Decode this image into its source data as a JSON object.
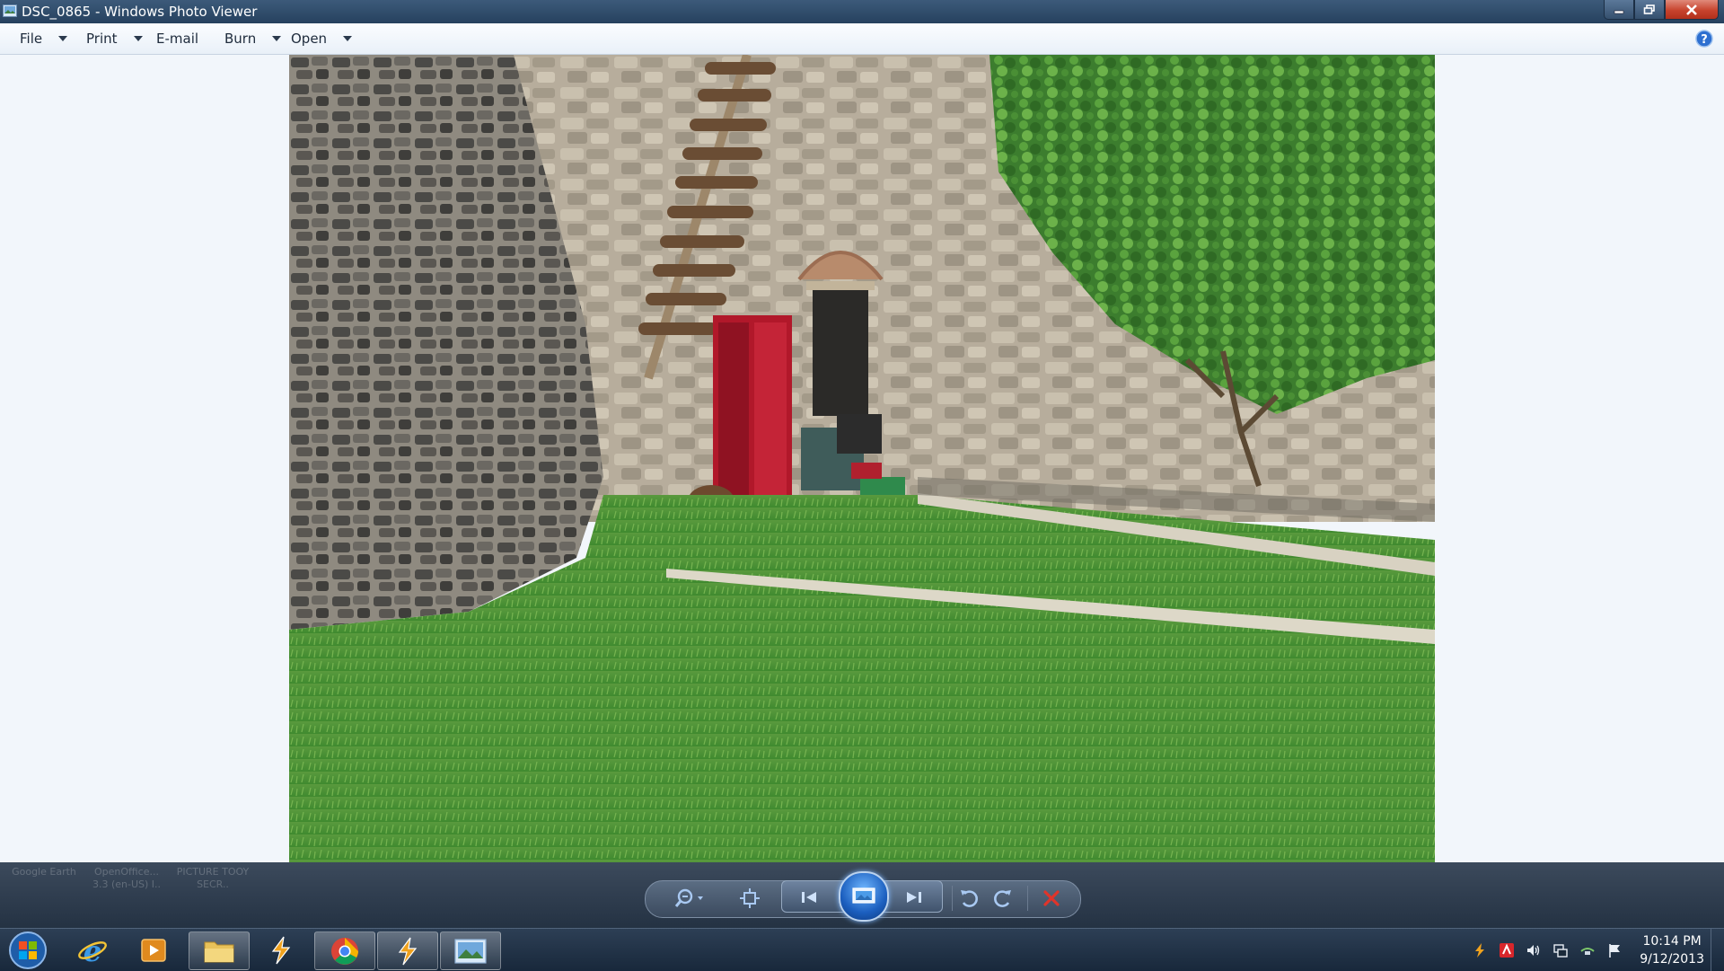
{
  "window": {
    "title": "DSC_0865 - Windows Photo Viewer"
  },
  "menu": {
    "file": "File",
    "print": "Print",
    "email": "E-mail",
    "burn": "Burn",
    "open": "Open"
  },
  "desktop_ghost_labels": [
    "Google Earth",
    "OpenOffice... 3.3 (en-US) I..",
    "PICTURE TOOY SECR.."
  ],
  "controls": [
    "zoom-icon",
    "actual-size-icon",
    "previous-icon",
    "slideshow-icon",
    "next-icon",
    "rotate-counterclockwise-icon",
    "rotate-clockwise-icon",
    "delete-icon"
  ],
  "taskbar": {
    "apps": [
      "internet-explorer",
      "media-player",
      "file-explorer",
      "winamp",
      "chrome",
      "winamp",
      "photo-viewer"
    ],
    "clock_time": "10:14 PM",
    "clock_date": "9/12/2013"
  },
  "colors": {
    "titlebar": "#2e4a69",
    "close_button": "#c7432d",
    "viewer_background": "#f2f6fb",
    "controlbar": "#2f3d4f",
    "accent_blue": "#1c5fbf",
    "delete_red": "#e0342a"
  }
}
